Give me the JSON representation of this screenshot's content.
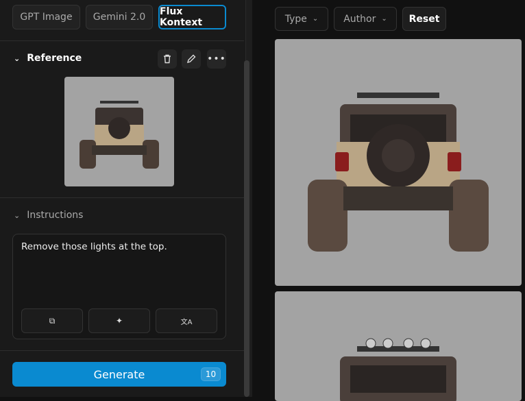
{
  "models": {
    "tabs": [
      {
        "label": "GPT Image"
      },
      {
        "label": "Gemini 2.0"
      },
      {
        "label": "Flux Kontext"
      }
    ],
    "active": "Flux Kontext"
  },
  "reference": {
    "title": "Reference"
  },
  "instructions": {
    "title": "Instructions",
    "value": "Remove those lights at the top."
  },
  "generate": {
    "label": "Generate",
    "count": "10"
  },
  "filters": {
    "type": "Type",
    "author": "Author",
    "reset": "Reset"
  },
  "colors": {
    "accent": "#0a8ad0"
  }
}
